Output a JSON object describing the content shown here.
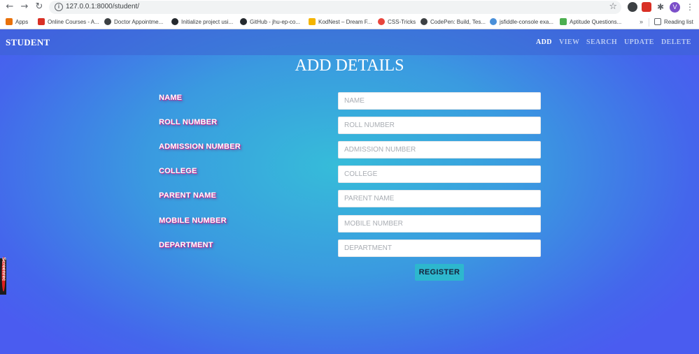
{
  "browser": {
    "url": "127.0.0.1:8000/student/",
    "avatar_letter": "V",
    "bookmarks": [
      {
        "label": "Apps",
        "color": "#e8710a"
      },
      {
        "label": "Online Courses - A...",
        "color": "#d93025"
      },
      {
        "label": "Doctor Appointme...",
        "color": "#3c4043"
      },
      {
        "label": "Initialize project usi...",
        "color": "#24292e"
      },
      {
        "label": "GitHub - jhu-ep-co...",
        "color": "#24292e"
      },
      {
        "label": "KodNest – Dream F...",
        "color": "#f4b400"
      },
      {
        "label": "CSS-Tricks",
        "color": "#e8453c"
      },
      {
        "label": "CodePen: Build, Tes...",
        "color": "#3c4043"
      },
      {
        "label": "jsfiddle-console exa...",
        "color": "#4a90d9"
      },
      {
        "label": "Aptitude Questions...",
        "color": "#4caf50"
      }
    ],
    "more": "»",
    "reading_list": "Reading list"
  },
  "navbar": {
    "brand": "STUDENT",
    "links": [
      "ADD",
      "VIEW",
      "SEARCH",
      "UPDATE",
      "DELETE"
    ]
  },
  "page": {
    "title": "ADD DETAILS"
  },
  "form": {
    "fields": [
      {
        "label": "NAME",
        "placeholder": "NAME",
        "value": ""
      },
      {
        "label": "ROLL NUMBER",
        "placeholder": "ROLL NUMBER",
        "value": ""
      },
      {
        "label": "ADMISSION NUMBER",
        "placeholder": "ADMISSION NUMBER",
        "value": ""
      },
      {
        "label": "COLLEGE",
        "placeholder": "COLLEGE",
        "value": ""
      },
      {
        "label": "PARENT NAME",
        "placeholder": "PARENT NAME",
        "value": ""
      },
      {
        "label": "MOBILE NUMBER",
        "placeholder": "MOBILE NUMBER",
        "value": ""
      },
      {
        "label": "DEPARTMENT",
        "placeholder": "DEPARTMENT",
        "value": ""
      }
    ],
    "submit_label": "REGISTER"
  },
  "overlay": {
    "badge_text": "Screenrec"
  }
}
